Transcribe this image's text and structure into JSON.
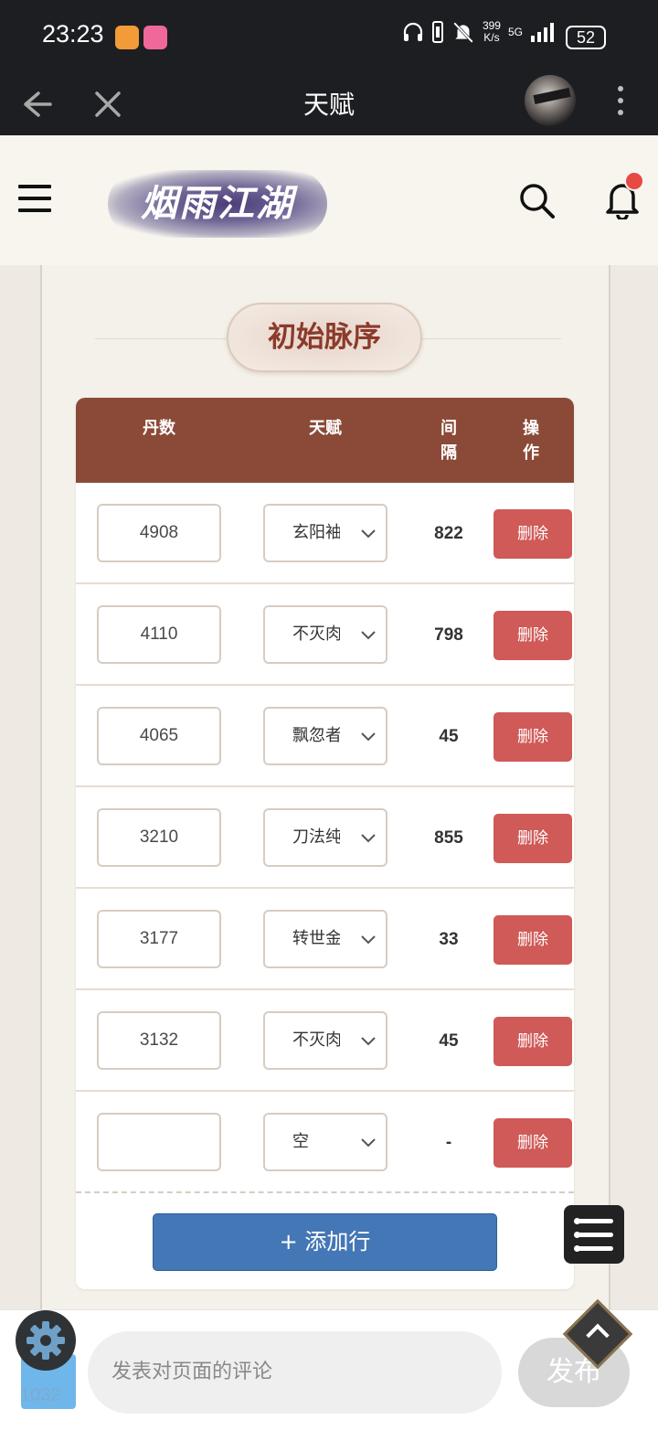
{
  "status_bar": {
    "time": "23:23",
    "net_speed_value": "399",
    "net_speed_unit": "K/s",
    "network": "5G",
    "battery": "52"
  },
  "app_bar": {
    "title": "天赋"
  },
  "site": {
    "logo_text": "烟雨江湖"
  },
  "section": {
    "title": "初始脉序"
  },
  "table": {
    "headers": {
      "dan": "丹数",
      "talent": "天赋",
      "gap_line1": "间",
      "gap_line2": "隔",
      "op_line1": "操",
      "op_line2": "作"
    },
    "rows": [
      {
        "dan": "4908",
        "talent": "玄阳袖",
        "gap": "822",
        "action": "删除"
      },
      {
        "dan": "4110",
        "talent": "不灭肉",
        "gap": "798",
        "action": "删除"
      },
      {
        "dan": "4065",
        "talent": "飘忽者",
        "gap": "45",
        "action": "删除"
      },
      {
        "dan": "3210",
        "talent": "刀法纯",
        "gap": "855",
        "action": "删除"
      },
      {
        "dan": "3177",
        "talent": "转世金",
        "gap": "33",
        "action": "删除"
      },
      {
        "dan": "3132",
        "talent": "不灭肉",
        "gap": "45",
        "action": "删除"
      },
      {
        "dan": "",
        "talent": "空",
        "gap": "-",
        "action": "删除"
      }
    ],
    "add_row_label": "+ 添加行"
  },
  "comment_bar": {
    "count": "1032",
    "placeholder": "发表对页面的评论",
    "publish_label": "发布"
  },
  "colors": {
    "header_brown": "#8b4a38",
    "delete_red": "#cf5a57",
    "add_blue": "#4477b5",
    "section_title": "#8b3a2b"
  }
}
